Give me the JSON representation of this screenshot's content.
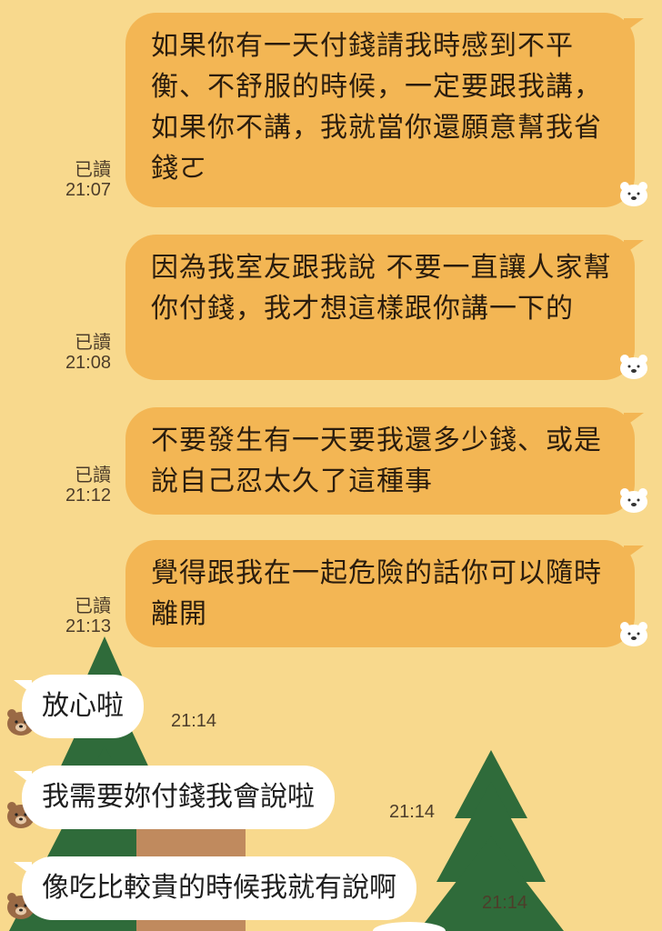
{
  "colors": {
    "background": "#f8d98d",
    "sent_bubble": "#f3b654",
    "received_bubble": "#ffffff",
    "tree": "#2f6b3a",
    "trunk": "#c08a5e"
  },
  "sent_messages": [
    {
      "text": "如果你有一天付錢請我時感到不平衡、不舒服的時候，一定要跟我講，如果你不講，我就當你還願意幫我省錢ㄛ",
      "read": "已讀",
      "time": "21:07"
    },
    {
      "text": "因為我室友跟我說 不要一直讓人家幫你付錢，我才想這樣跟你講一下的",
      "read": "已讀",
      "time": "21:08"
    },
    {
      "text": "不要發生有一天要我還多少錢、或是說自己忍太久了這種事",
      "read": "已讀",
      "time": "21:12"
    },
    {
      "text": "覺得跟我在一起危險的話你可以隨時離開",
      "read": "已讀",
      "time": "21:13"
    }
  ],
  "received_messages": [
    {
      "text": "放心啦",
      "time": "21:14"
    },
    {
      "text": "我需要妳付錢我會說啦",
      "time": "21:14"
    },
    {
      "text": "像吃比較貴的時候我就有說啊",
      "time": "21:14"
    }
  ],
  "icons": {
    "sender_sticker": "polar-bear-icon",
    "contact_avatar": "brown-bear-icon"
  }
}
